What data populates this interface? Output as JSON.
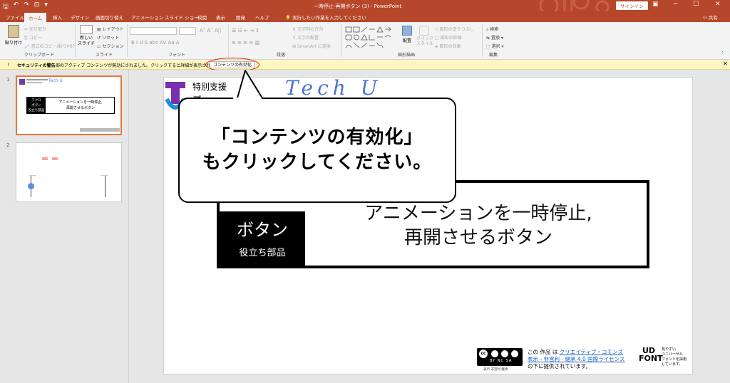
{
  "titlebar": {
    "title": "一時停止-再開ボタン (3) - PowerPoint",
    "signin": "サインイン",
    "quick_access": [
      "save-icon",
      "undo-icon",
      "redo-icon",
      "present-icon"
    ]
  },
  "tabs": [
    "ファイル",
    "ホーム",
    "挿入",
    "デザイン",
    "画面切り替え",
    "アニメーション",
    "スライド ショー",
    "校閲",
    "表示",
    "開発",
    "ヘルプ"
  ],
  "active_tab": "ホーム",
  "tell_me": "実行したい作業を入力してください",
  "share": "共有",
  "ribbon": {
    "clipboard": {
      "label": "クリップボード",
      "paste": "貼り付け",
      "cut": "切り取り",
      "copy": "コピー",
      "format_painter": "書式のコピー/貼り付け"
    },
    "slides": {
      "label": "スライド",
      "new_slide": "新しい\nスライド",
      "layout": "レイアウト",
      "reset": "リセット",
      "section": "セクション"
    },
    "font": {
      "label": "フォント",
      "buttons": "B  I  U  S  abc  AV  Aa  A"
    },
    "paragraph": {
      "label": "段落",
      "text_direction": "文字列の方向",
      "align_text": "文字の配置",
      "smartart": "SmartArt に変換"
    },
    "drawing": {
      "label": "図形描画",
      "arrange": "配置",
      "quick_styles": "クイック\nスタイル",
      "fill": "図形の塗りつぶし",
      "outline": "図形の枠線",
      "effects": "図形の効果"
    },
    "editing": {
      "label": "編集",
      "find": "検索",
      "replace": "置換",
      "select": "選択"
    }
  },
  "security_bar": {
    "title": "セキュリティの警告",
    "message": "一部のアクティブ コンテンツが無効にされました。クリックすると詳細が表示されます。",
    "button": "コンテンツの有効化"
  },
  "slides": [
    {
      "number": "1",
      "selected": true,
      "label_box": [
        "マクロ",
        "ボタン",
        "役立ち部品"
      ],
      "main_text": [
        "アニメーションを一時停止,",
        "再開させるボタン"
      ]
    },
    {
      "number": "2",
      "selected": false
    }
  ],
  "slide": {
    "header_text": "特別支援",
    "header_text2": "プ",
    "handwriting": "Tech U",
    "box_title": "ボタン",
    "box_subtitle": "役立ち部品",
    "main_line1": "アニメーションを一時停止,",
    "main_line2": "再開させるボタン",
    "cc_badge": "BY NC SA",
    "cc_sub": "表示 非営利 継承",
    "license_line1_prefix": "この 作品 は ",
    "license_link1": "クリエイティブ・コモンズ",
    "license_link2": "表示 - 非営利 - 継承 4.0 国際ライセンス",
    "license_line3": "の下に提供されています。",
    "udfont": "UD FONT",
    "udfont_note": "見やすい\nユニバーサル\nフォントを採用\nしています。"
  },
  "callout": {
    "line1": "「コンテンツの有効化」",
    "line2": "もクリックしてください。"
  }
}
